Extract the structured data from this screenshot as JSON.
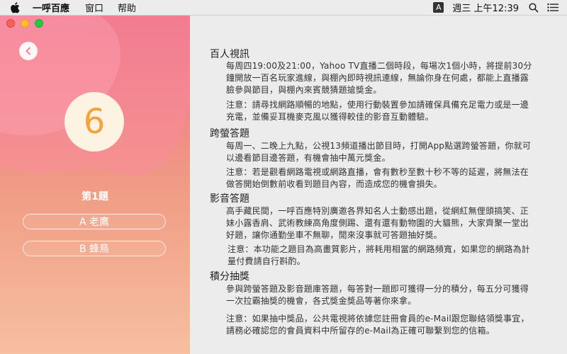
{
  "menubar": {
    "app_name": "一呼百應",
    "items": [
      "窗口",
      "帮助"
    ],
    "input_source": "A",
    "clock": "週三 上午12:39"
  },
  "left": {
    "question_number": "6",
    "question_title": "第1題",
    "options": [
      "A 老鷹",
      "B 蜂鳥"
    ]
  },
  "sections": [
    {
      "title": "百人視訊",
      "body": "每周四19:00及21:00，Yahoo TV直播二個時段，每場次1個小時，將提前30分鐘開放一百名玩家進線，與棚內即時視訊連線，無論你身在何處，都能上直播露臉參與節目，與棚內來賓競猜題搶獎金。",
      "note": "注意：請尋找網路順暢的地點，使用行動裝置參加請確保具備充足電力或是一邊充電，並備妥耳機麥克風以獲得較佳的影音互動體驗。"
    },
    {
      "title": "跨螢答題",
      "body": "每周一、二晚上九點，公視13頻道播出節目時，打開App點選跨螢答題，你就可以邊看節目邊答題，有機會抽中萬元獎金。",
      "note": "注意：若是觀看網路電視或網路直播，會有數秒至數十秒不等的延遲，將無法在做答開始倒數前收看到題目內容，而造成您的機會損失。"
    },
    {
      "title": "影音答題",
      "body": "高手藏民間，一呼百應特別廣邀各界知名人士動感出題，從網紅無俚頭搞笑、正妹小露香肩、武術教練高角度側踢、還有還有動物園的大貓熊，大家齊聚一堂出好題，讓你通勤坐車不無聊，閒來沒事就可答題抽好獎。",
      "note": "注意：本功能之題目為高畫質影片，將耗用相當的網路頻寬，如果您的網路為計量付費請自行斟酌。"
    },
    {
      "title": "積分抽獎",
      "body": "參與跨螢答題及影音題庫答題，每答對一題即可獲得一分的積分，每五分可獲得一次拉霸抽獎的機會，各式獎金獎品等著你來拿。",
      "note": "注意：如果抽中獎品，公共電視將依據您註冊會員的e-Mail跟您聯絡領獎事宜，請務必確認您的會員資料中所留存的e-Mail為正確可聯繫到您的信箱。"
    }
  ]
}
